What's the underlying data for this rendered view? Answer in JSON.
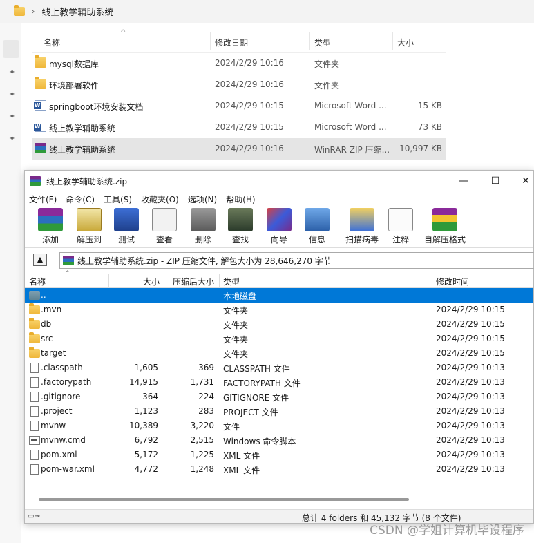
{
  "explorer": {
    "breadcrumb": "线上教学辅助系统",
    "columns": {
      "name": "名称",
      "date": "修改日期",
      "type": "类型",
      "size": "大小"
    },
    "rows": [
      {
        "name": "mysql数据库",
        "date": "2024/2/29 10:16",
        "type": "文件夹",
        "size": "",
        "icon": "folder-icon"
      },
      {
        "name": "环境部署软件",
        "date": "2024/2/29 10:16",
        "type": "文件夹",
        "size": "",
        "icon": "folder-icon"
      },
      {
        "name": "springboot环境安装文档",
        "date": "2024/2/29 10:15",
        "type": "Microsoft Word ...",
        "size": "15 KB",
        "icon": "word-doc-icon"
      },
      {
        "name": "线上教学辅助系统",
        "date": "2024/2/29 10:15",
        "type": "Microsoft Word ...",
        "size": "73 KB",
        "icon": "word-doc-icon"
      },
      {
        "name": "线上教学辅助系统",
        "date": "2024/2/29 10:16",
        "type": "WinRAR ZIP 压缩...",
        "size": "10,997 KB",
        "icon": "rar-archive-icon"
      }
    ]
  },
  "winrar": {
    "title": "线上教学辅助系统.zip",
    "menu": [
      "文件(F)",
      "命令(C)",
      "工具(S)",
      "收藏夹(O)",
      "选项(N)",
      "帮助(H)"
    ],
    "toolbar": [
      "添加",
      "解压到",
      "测试",
      "查看",
      "删除",
      "查找",
      "向导",
      "信息",
      "扫描病毒",
      "注释",
      "自解压格式"
    ],
    "path": "线上教学辅助系统.zip - ZIP 压缩文件, 解包大小为 28,646,270 字节",
    "columns": {
      "name": "名称",
      "size": "大小",
      "packed": "压缩后大小",
      "type": "类型",
      "modified": "修改时间"
    },
    "rows": [
      {
        "name": "..",
        "size": "",
        "packed": "",
        "type": "本地磁盘",
        "modified": "",
        "icon": "parent-folder-icon"
      },
      {
        "name": ".mvn",
        "size": "",
        "packed": "",
        "type": "文件夹",
        "modified": "2024/2/29 10:15",
        "icon": "folder-icon"
      },
      {
        "name": "db",
        "size": "",
        "packed": "",
        "type": "文件夹",
        "modified": "2024/2/29 10:15",
        "icon": "folder-icon"
      },
      {
        "name": "src",
        "size": "",
        "packed": "",
        "type": "文件夹",
        "modified": "2024/2/29 10:15",
        "icon": "folder-icon"
      },
      {
        "name": "target",
        "size": "",
        "packed": "",
        "type": "文件夹",
        "modified": "2024/2/29 10:15",
        "icon": "folder-icon"
      },
      {
        "name": ".classpath",
        "size": "1,605",
        "packed": "369",
        "type": "CLASSPATH 文件",
        "modified": "2024/2/29 10:13",
        "icon": "file-icon"
      },
      {
        "name": ".factorypath",
        "size": "14,915",
        "packed": "1,731",
        "type": "FACTORYPATH 文件",
        "modified": "2024/2/29 10:13",
        "icon": "file-icon"
      },
      {
        "name": ".gitignore",
        "size": "364",
        "packed": "224",
        "type": "GITIGNORE 文件",
        "modified": "2024/2/29 10:13",
        "icon": "file-icon"
      },
      {
        "name": ".project",
        "size": "1,123",
        "packed": "283",
        "type": "PROJECT 文件",
        "modified": "2024/2/29 10:13",
        "icon": "file-icon"
      },
      {
        "name": "mvnw",
        "size": "10,389",
        "packed": "3,220",
        "type": "文件",
        "modified": "2024/2/29 10:13",
        "icon": "file-icon"
      },
      {
        "name": "mvnw.cmd",
        "size": "6,792",
        "packed": "2,515",
        "type": "Windows 命令脚本",
        "modified": "2024/2/29 10:13",
        "icon": "cmd-script-icon"
      },
      {
        "name": "pom.xml",
        "size": "5,172",
        "packed": "1,225",
        "type": "XML 文件",
        "modified": "2024/2/29 10:13",
        "icon": "file-icon"
      },
      {
        "name": "pom-war.xml",
        "size": "4,772",
        "packed": "1,248",
        "type": "XML 文件",
        "modified": "2024/2/29 10:13",
        "icon": "file-icon"
      }
    ],
    "status": "总计 4 folders 和 45,132 字节 (8 个文件)"
  },
  "watermark": "CSDN @学姐计算机毕设程序",
  "colors": {
    "selection": "#0078d7",
    "folder": "#efb73a"
  }
}
